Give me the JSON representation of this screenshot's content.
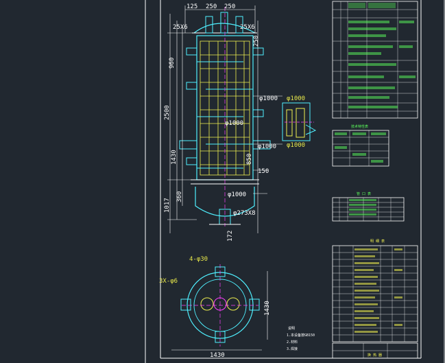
{
  "drawing": {
    "dims_top": [
      "125",
      "250",
      "250",
      "25X6",
      "25X6"
    ],
    "dims_left": [
      "960",
      "2500",
      "1430",
      "360",
      "1017"
    ],
    "dims_right": [
      "φ1000",
      "φ1000",
      "φ1000",
      "150",
      "φ1000",
      "φ273X8",
      "172",
      "850",
      "250"
    ],
    "section_labels": [
      "φ1000",
      "φ1000"
    ],
    "plan_labels": [
      "4-φ30",
      "3X-φ6",
      "1430",
      "1430"
    ],
    "notes": [
      "说明",
      "1.本设备按GB150",
      "2.材料",
      "3.焊接"
    ]
  },
  "tables": {
    "tech_title": "技术特性表",
    "nozzle_title": "管 口 表",
    "parts_title": "明 细 表",
    "title_block": "换 热 器"
  }
}
